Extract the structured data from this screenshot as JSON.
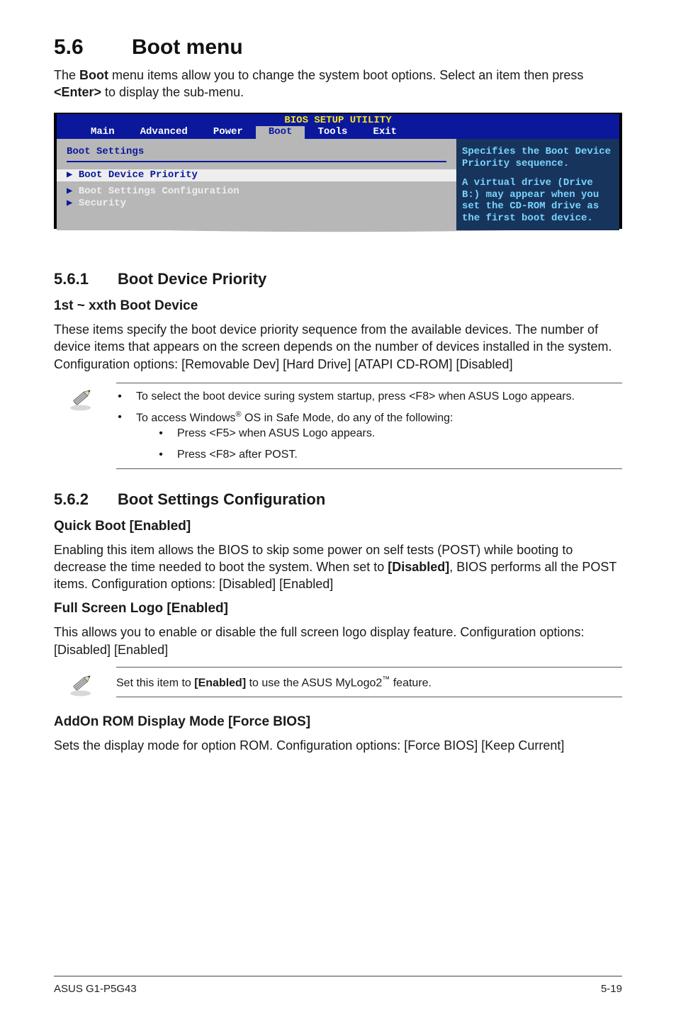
{
  "h1": {
    "num": "5.6",
    "title": "Boot menu"
  },
  "intro_a": "The ",
  "intro_b": "Boot",
  "intro_c": " menu items allow you to change the system boot options. Select an item then press ",
  "intro_d": "<Enter>",
  "intro_e": " to display the sub-menu.",
  "bios": {
    "title": "BIOS SETUP UTILITY",
    "tabs": [
      "Main",
      "Advanced",
      "Power",
      "Boot",
      "Tools",
      "Exit"
    ],
    "section": "Boot Settings",
    "items": [
      "Boot Device Priority",
      "Boot Settings Configuration",
      "Security"
    ],
    "help1": "Specifies the Boot Device Priority sequence.",
    "help2": "A virtual drive (Drive B:) may appear when you set the CD-ROM drive as the first boot device."
  },
  "s561": {
    "num": "5.6.1",
    "title": "Boot Device Priority"
  },
  "s561_h3": "1st ~ xxth Boot Device",
  "s561_p": "These items specify the boot device priority sequence from the available devices. The number of device items that appears on the screen depends on the number of devices installed in the system. Configuration options: [Removable Dev] [Hard Drive] [ATAPI CD-ROM] [Disabled]",
  "note1": {
    "b1": "To select the boot device suring system startup, press <F8> when ASUS Logo appears.",
    "b2a": "To access Windows",
    "b2b": " OS in Safe Mode, do any of the following:",
    "b2s1": "Press <F5> when ASUS Logo appears.",
    "b2s2": "Press <F8> after POST."
  },
  "s562": {
    "num": "5.6.2",
    "title": "Boot Settings Configuration"
  },
  "quick_h": "Quick Boot [Enabled]",
  "quick_p_a": "Enabling this item allows the BIOS to skip some power on self tests (POST) while booting to decrease the time needed to boot the system. When set to ",
  "quick_p_b": "[Disabled]",
  "quick_p_c": ", BIOS performs all the POST items. Configuration options: [Disabled] [Enabled]",
  "full_h": "Full Screen Logo [Enabled]",
  "full_p": "This allows you to enable or disable the full screen logo display feature. Configuration options: [Disabled] [Enabled]",
  "note2_a": "Set this item to ",
  "note2_b": "[Enabled]",
  "note2_c": " to use the ASUS MyLogo2",
  "note2_d": " feature.",
  "addon_h": "AddOn ROM Display Mode [Force BIOS]",
  "addon_p": "Sets the display mode for option ROM. Configuration options: [Force BIOS] [Keep Current]",
  "footer": {
    "left": "ASUS G1-P5G43",
    "right": "5-19"
  }
}
